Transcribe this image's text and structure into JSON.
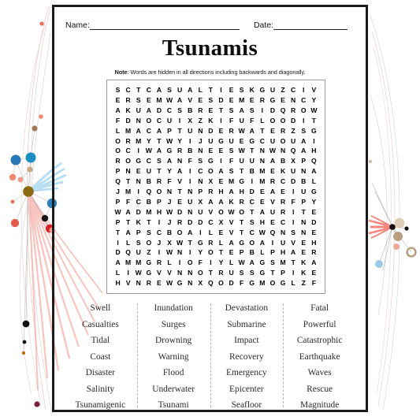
{
  "header": {
    "name_label": "Name:",
    "date_label": "Date:"
  },
  "title": "Tsunamis",
  "note": {
    "prefix": "Note",
    "separator": ":",
    "text": " Words are hidden in all directions including backwards and diagonally."
  },
  "grid": {
    "rows": 20,
    "cols": 19,
    "letters": [
      [
        "S",
        "C",
        "T",
        "C",
        "A",
        "S",
        "U",
        "A",
        "L",
        "T",
        "I",
        "E",
        "S",
        "K",
        "G",
        "U",
        "Z",
        "C",
        "I",
        "V"
      ],
      [
        "E",
        "R",
        "S",
        "E",
        "M",
        "W",
        "A",
        "V",
        "E",
        "S",
        "D",
        "E",
        "M",
        "E",
        "R",
        "G",
        "E",
        "N",
        "C",
        "Y"
      ],
      [
        "A",
        "K",
        "U",
        "A",
        "D",
        "C",
        "S",
        "B",
        "R",
        "E",
        "T",
        "S",
        "A",
        "S",
        "I",
        "D",
        "Q",
        "R",
        "O",
        "W"
      ],
      [
        "F",
        "D",
        "N",
        "O",
        "C",
        "U",
        "I",
        "X",
        "Z",
        "K",
        "I",
        "F",
        "U",
        "F",
        "L",
        "O",
        "O",
        "D",
        "I",
        "T"
      ],
      [
        "L",
        "M",
        "A",
        "C",
        "A",
        "P",
        "T",
        "U",
        "N",
        "D",
        "E",
        "R",
        "W",
        "A",
        "T",
        "E",
        "R",
        "Z",
        "S",
        "G"
      ],
      [
        "O",
        "R",
        "M",
        "Y",
        "T",
        "W",
        "Y",
        "I",
        "J",
        "U",
        "G",
        "U",
        "E",
        "G",
        "C",
        "U",
        "O",
        "U",
        "A",
        "I"
      ],
      [
        "O",
        "C",
        "I",
        "W",
        "A",
        "G",
        "R",
        "B",
        "N",
        "E",
        "E",
        "S",
        "W",
        "T",
        "N",
        "W",
        "N",
        "Q",
        "A",
        "H"
      ],
      [
        "R",
        "O",
        "G",
        "C",
        "S",
        "A",
        "N",
        "F",
        "S",
        "G",
        "I",
        "F",
        "U",
        "U",
        "N",
        "A",
        "B",
        "X",
        "P",
        "Q"
      ],
      [
        "P",
        "N",
        "E",
        "U",
        "T",
        "Y",
        "A",
        "I",
        "C",
        "O",
        "A",
        "S",
        "T",
        "B",
        "M",
        "E",
        "K",
        "U",
        "N",
        "A"
      ],
      [
        "Q",
        "T",
        "N",
        "B",
        "R",
        "F",
        "V",
        "I",
        "N",
        "X",
        "E",
        "M",
        "G",
        "I",
        "M",
        "R",
        "C",
        "D",
        "B",
        "L"
      ],
      [
        "J",
        "M",
        "I",
        "Q",
        "O",
        "N",
        "T",
        "N",
        "P",
        "R",
        "H",
        "A",
        "H",
        "D",
        "E",
        "A",
        "E",
        "I",
        "U",
        "G"
      ],
      [
        "P",
        "F",
        "C",
        "B",
        "P",
        "J",
        "E",
        "U",
        "X",
        "A",
        "A",
        "K",
        "R",
        "C",
        "E",
        "V",
        "R",
        "F",
        "P",
        "Y"
      ],
      [
        "W",
        "A",
        "D",
        "M",
        "H",
        "W",
        "D",
        "N",
        "U",
        "V",
        "O",
        "W",
        "O",
        "T",
        "A",
        "U",
        "R",
        "I",
        "T",
        "E"
      ],
      [
        "P",
        "T",
        "K",
        "T",
        "I",
        "J",
        "R",
        "D",
        "D",
        "C",
        "X",
        "V",
        "T",
        "S",
        "H",
        "E",
        "C",
        "I",
        "N",
        "D"
      ],
      [
        "T",
        "A",
        "P",
        "S",
        "C",
        "B",
        "O",
        "A",
        "I",
        "L",
        "E",
        "V",
        "T",
        "C",
        "W",
        "Q",
        "N",
        "S",
        "N",
        "E"
      ],
      [
        "I",
        "L",
        "S",
        "O",
        "J",
        "X",
        "W",
        "T",
        "G",
        "R",
        "L",
        "A",
        "G",
        "O",
        "A",
        "I",
        "U",
        "V",
        "E",
        "H"
      ],
      [
        "D",
        "Q",
        "U",
        "Z",
        "I",
        "W",
        "N",
        "I",
        "Y",
        "O",
        "T",
        "E",
        "P",
        "B",
        "L",
        "P",
        "H",
        "A",
        "E",
        "R"
      ],
      [
        "A",
        "M",
        "M",
        "G",
        "R",
        "L",
        "I",
        "O",
        "F",
        "I",
        "Y",
        "L",
        "W",
        "A",
        "G",
        "S",
        "M",
        "T",
        "K",
        "A"
      ],
      [
        "L",
        "I",
        "W",
        "G",
        "V",
        "V",
        "N",
        "N",
        "O",
        "T",
        "R",
        "U",
        "S",
        "S",
        "G",
        "T",
        "P",
        "I",
        "K",
        "E"
      ],
      [
        "H",
        "V",
        "N",
        "R",
        "E",
        "W",
        "G",
        "N",
        "X",
        "Q",
        "O",
        "D",
        "F",
        "G",
        "M",
        "O",
        "G",
        "L",
        "Z",
        "F"
      ]
    ]
  },
  "word_list": {
    "columns": [
      {
        "words": [
          "Swell",
          "Casualties",
          "Tidal",
          "Coast",
          "Disaster",
          "Salinity",
          "Tsunamigenic"
        ]
      },
      {
        "words": [
          "Inundation",
          "Surges",
          "Drowning",
          "Warning",
          "Flood",
          "Underwater",
          "Tsunami"
        ]
      },
      {
        "words": [
          "Devastation",
          "Submarine",
          "Impact",
          "Recovery",
          "Emergency",
          "Epicenter",
          "Seafloor"
        ]
      },
      {
        "words": [
          "Fatal",
          "Powerful",
          "Catastrophic",
          "Earthquake",
          "Waves",
          "Rescue",
          "Magnitude"
        ]
      }
    ]
  },
  "colors": {
    "page_border": "#1b1b1b",
    "grid_border": "#9a9a9a",
    "text": "#0d0d0d",
    "word_text": "#2b2b2b",
    "divider": "#b4b4b4",
    "node_blue": "#2878b8",
    "node_cyan": "#1a8fc0",
    "node_gold": "#8a6a12",
    "node_red": "#d92020",
    "node_salmon": "#e8705a",
    "node_black": "#111111",
    "node_tan": "#c8a882",
    "edge_red": "#f4a09a",
    "edge_blue": "#a8d8ef",
    "edge_grey": "#c9c4bd"
  }
}
